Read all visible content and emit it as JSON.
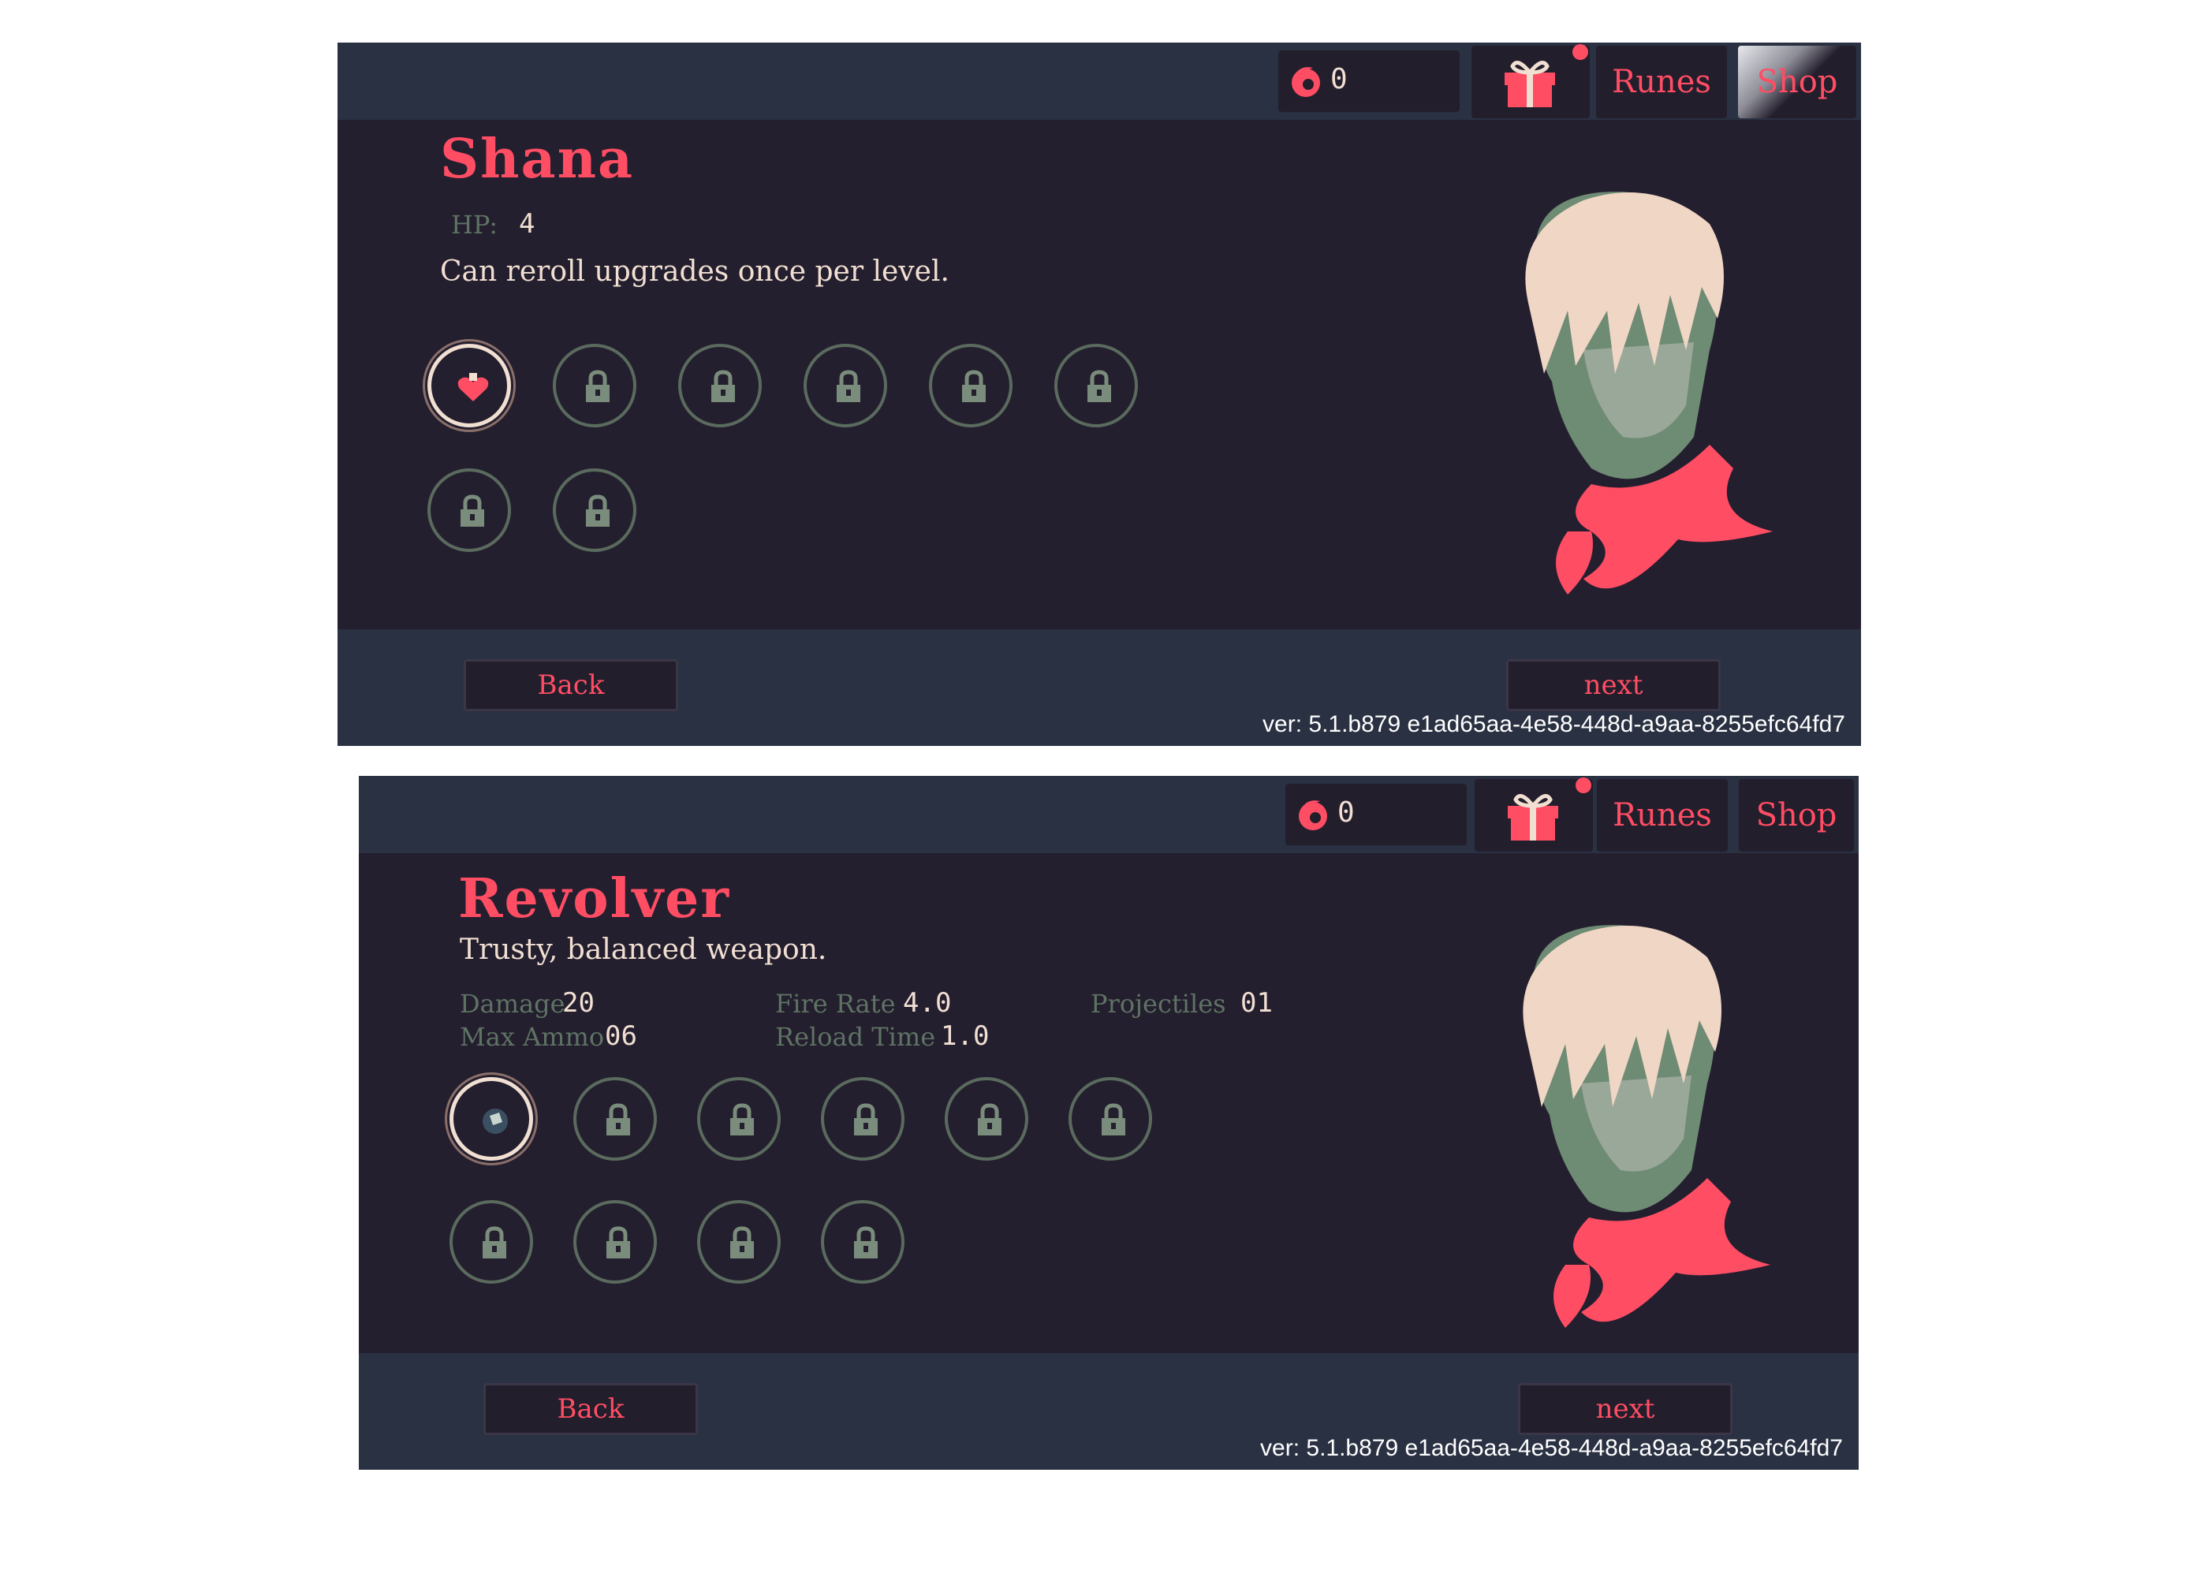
{
  "screens": [
    {
      "currency_value": "0",
      "runes_label": "Runes",
      "shop_label": "Shop",
      "title": "Shana",
      "hp_label": "HP:",
      "hp_value": "4",
      "description": "Can reroll upgrades once per level.",
      "back_label": "Back",
      "next_label": "next",
      "version": "ver: 5.1.b879 e1ad65aa-4e58-448d-a9aa-8255efc64fd7"
    },
    {
      "currency_value": "0",
      "runes_label": "Runes",
      "shop_label": "Shop",
      "title": "Revolver",
      "description": "Trusty, balanced weapon.",
      "stats": {
        "damage_label": "Damage",
        "damage_value": "20",
        "fire_rate_label": "Fire Rate",
        "fire_rate_value": "4.0",
        "projectiles_label": "Projectiles",
        "projectiles_value": "01",
        "max_ammo_label": "Max Ammo",
        "max_ammo_value": "06",
        "reload_time_label": "Reload Time",
        "reload_time_value": "1.0"
      },
      "back_label": "Back",
      "next_label": "next",
      "version": "ver: 5.1.b879 e1ad65aa-4e58-448d-a9aa-8255efc64fd7"
    }
  ],
  "colors": {
    "accent": "#ff4d64",
    "panel_bg": "#241f2e",
    "bar_bg": "#2a3142",
    "text_light": "#f1dfd2",
    "stat_label": "#5e7364"
  },
  "icons": {
    "currency": "soul-coin-icon",
    "gift": "gift-box-icon",
    "locked_slot": "lock-icon",
    "selected_slot_1": "heart-upgrade-icon",
    "selected_slot_2": "bullet-upgrade-icon"
  }
}
